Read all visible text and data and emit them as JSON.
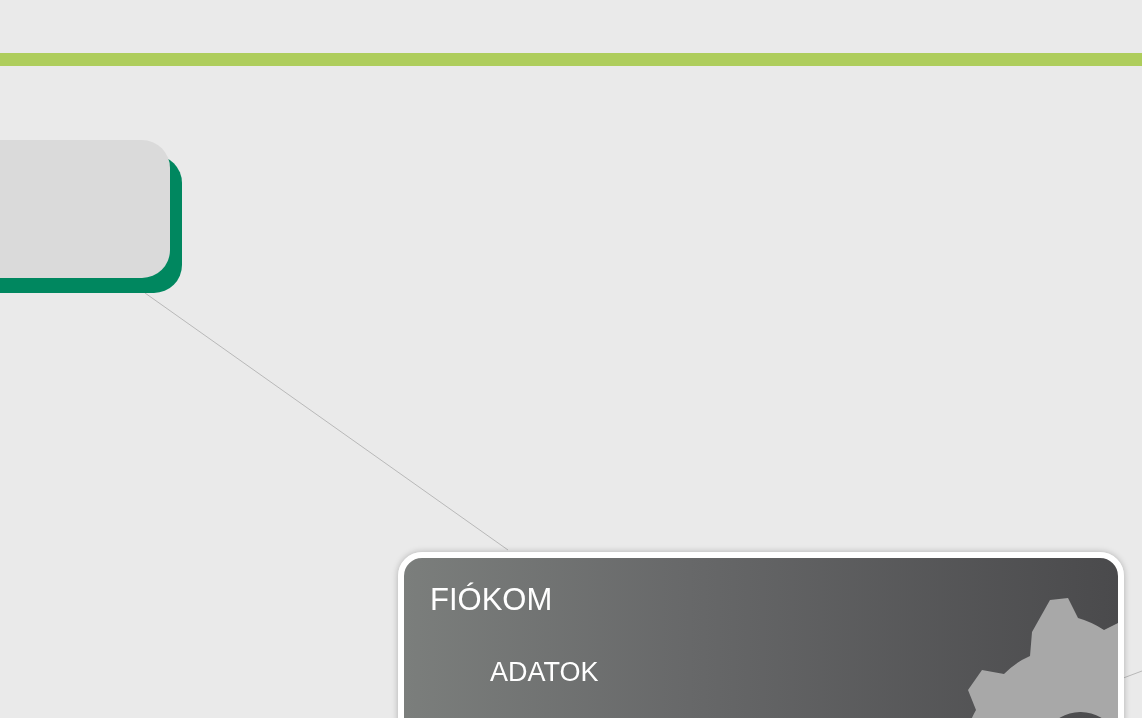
{
  "menu_card": {
    "title": "FIÓKOM",
    "items": [
      {
        "label": "ADATOK"
      }
    ]
  }
}
